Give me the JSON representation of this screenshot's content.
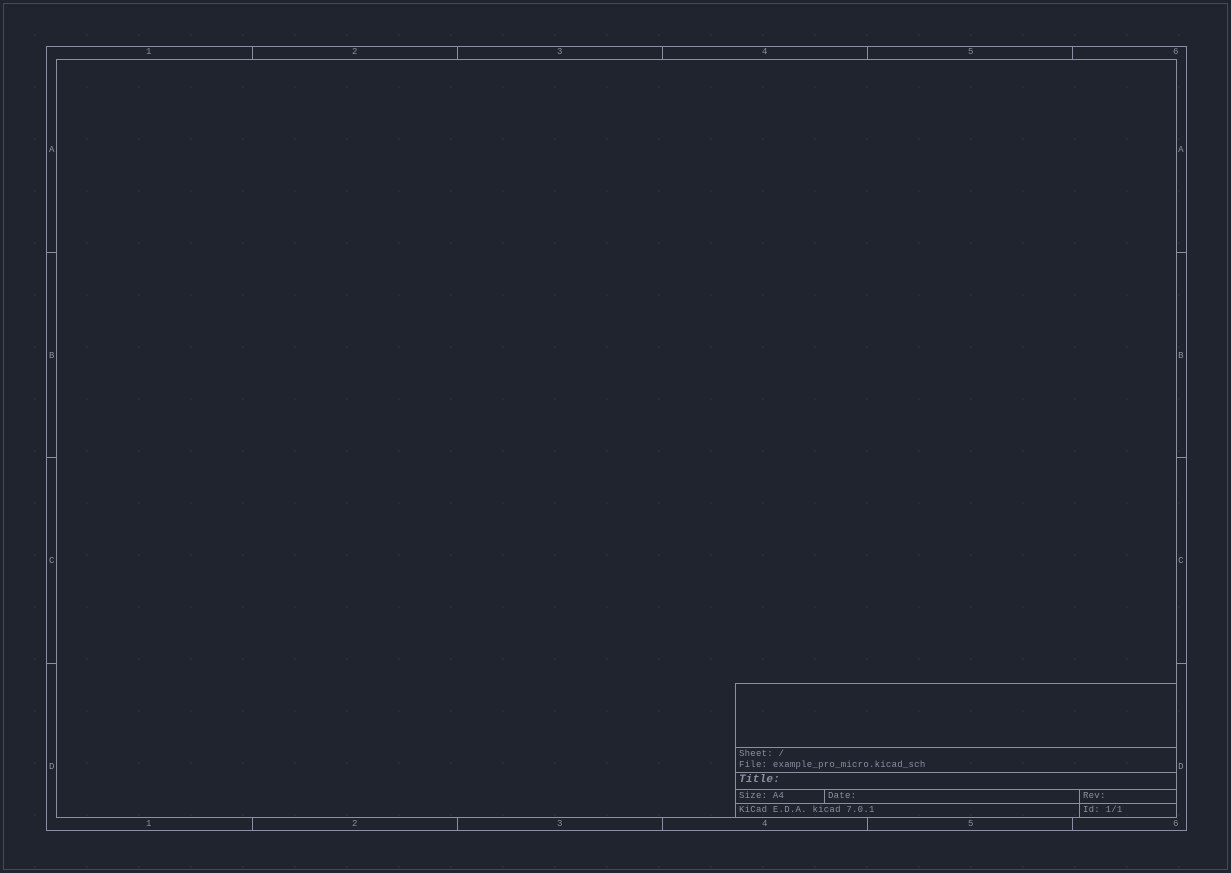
{
  "ruler": {
    "columns": [
      "1",
      "2",
      "3",
      "4",
      "5",
      "6"
    ],
    "rows": [
      "A",
      "B",
      "C",
      "D"
    ]
  },
  "titleblock": {
    "sheet_label": "Sheet: /",
    "file_label": "File: example_pro_micro.kicad_sch",
    "title_label": "Title:",
    "size_label": "Size: A4",
    "date_label": "Date:",
    "rev_label": "Rev:",
    "generator_label": "KiCad E.D.A.  kicad 7.0.1",
    "id_label": "Id: 1/1"
  }
}
